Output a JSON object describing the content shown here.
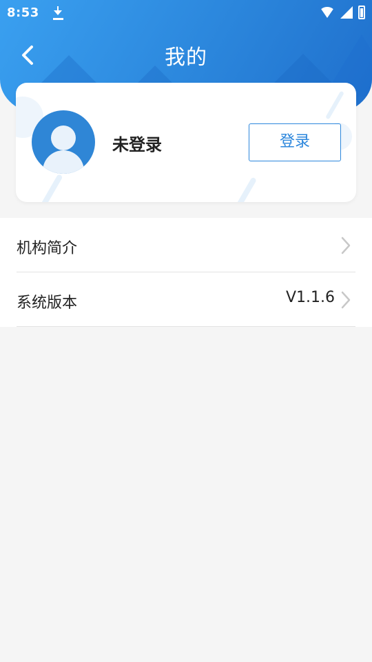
{
  "status_bar": {
    "time": "8:53"
  },
  "header": {
    "title": "我的",
    "back_icon": "chevron-left-icon"
  },
  "profile": {
    "name": "未登录",
    "login_label": "登录",
    "avatar_icon": "user-avatar-icon"
  },
  "menu": {
    "items": [
      {
        "label": "机构简介",
        "value": ""
      },
      {
        "label": "系统版本",
        "value": "V1.1.6"
      }
    ]
  },
  "colors": {
    "accent": "#2b86dc",
    "header_start": "#3aa0f0",
    "header_end": "#1f6fcc",
    "background": "#f5f5f5"
  }
}
